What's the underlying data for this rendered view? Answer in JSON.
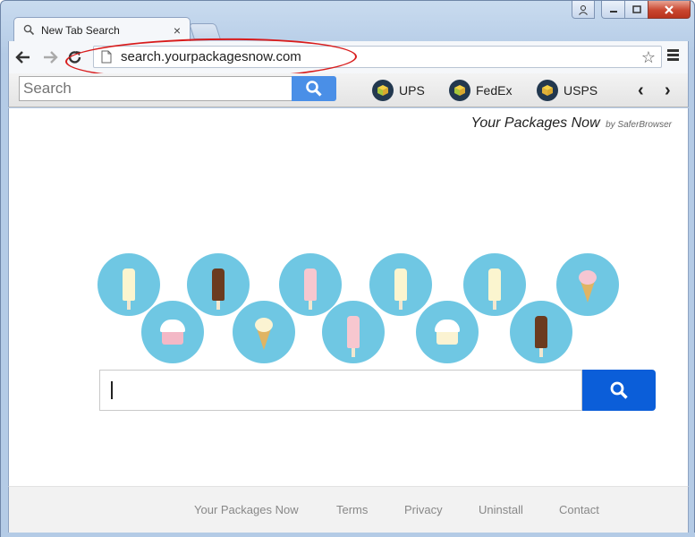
{
  "browser": {
    "tab_title": "New Tab Search",
    "tab_close": "×",
    "url": "search.yourpackagesnow.com",
    "star": "☆"
  },
  "extension_bar": {
    "search_placeholder": "Search",
    "links": [
      {
        "label": "UPS"
      },
      {
        "label": "FedEx"
      },
      {
        "label": "USPS"
      }
    ],
    "prev": "‹",
    "next": "›"
  },
  "page": {
    "brand": "Your Packages Now",
    "brand_sub": "by SaferBrowser",
    "search_value": ""
  },
  "footer": {
    "links": [
      "Your Packages Now",
      "Terms",
      "Privacy",
      "Uninstall",
      "Contact"
    ]
  },
  "colors": {
    "circle": "#6fc7e3",
    "search_button": "#0b5ed9",
    "annotation_oval": "#d81c1c"
  }
}
